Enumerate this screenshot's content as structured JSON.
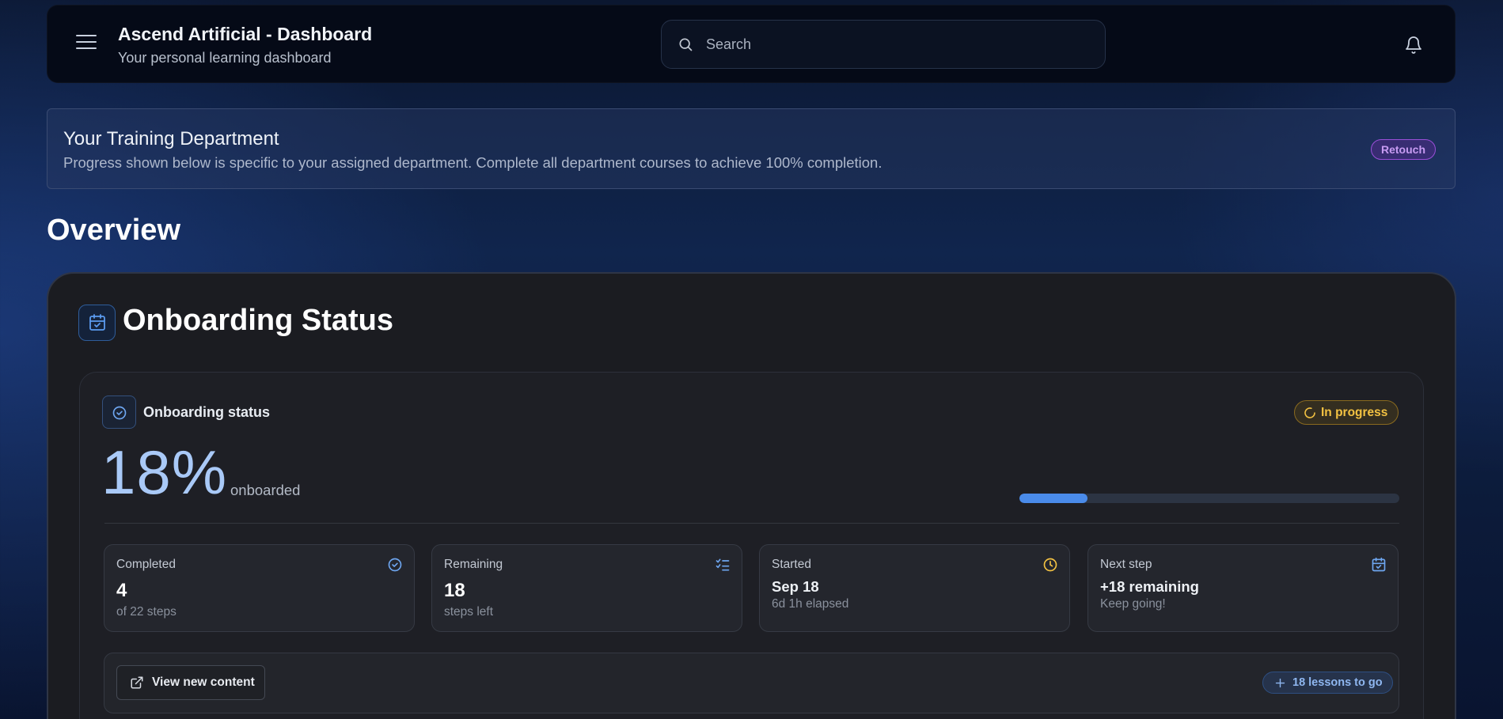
{
  "header": {
    "title": "Ascend Artificial - Dashboard",
    "subtitle": "Your personal learning dashboard",
    "search_placeholder": "Search"
  },
  "department": {
    "title": "Your Training Department",
    "description": "Progress shown below is specific to your assigned department. Complete all department courses to achieve 100% completion.",
    "badge": "Retouch"
  },
  "overview_heading": "Overview",
  "onboarding": {
    "card_title": "Onboarding Status",
    "status_label": "Onboarding status",
    "status_badge": "In progress",
    "percent_text": "18%",
    "percent_suffix": "onboarded",
    "progress_fraction": 0.18,
    "stats": [
      {
        "label": "Completed",
        "value": "4",
        "sub": "of 22 steps",
        "icon": "check-circle-icon"
      },
      {
        "label": "Remaining",
        "value": "18",
        "sub": "steps left",
        "icon": "list-checks-icon"
      },
      {
        "label": "Started",
        "value": "Sep 18",
        "sub": "6d 1h elapsed",
        "icon": "clock-icon"
      },
      {
        "label": "Next step",
        "value": "+18 remaining",
        "sub": "Keep going!",
        "icon": "calendar-check-icon"
      }
    ],
    "view_button": "View new content",
    "lessons_badge": "18 lessons to go"
  },
  "colors": {
    "accent_blue": "#4a8bea",
    "badge_purple": "#9b4fd9",
    "badge_amber": "#f3c242"
  }
}
